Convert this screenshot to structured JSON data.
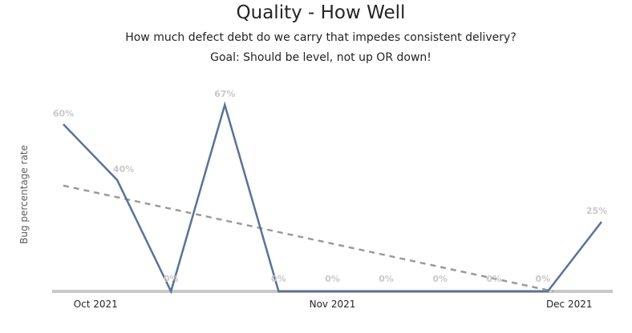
{
  "header": {
    "title": "Quality - How Well",
    "subtitle": "How much defect debt do we carry that impedes consistent delivery?",
    "goal": "Goal: Should be level, not up OR down!"
  },
  "colors": {
    "series_line": "#5b7295",
    "trend_line": "#9a9a9a",
    "axis_line": "#c8c8c8",
    "data_label": "#c8c8c8"
  },
  "chart_data": {
    "type": "line",
    "title": "Quality - How Well",
    "ylabel": "Bug percentage rate",
    "xlabel": "",
    "x_ticks": [
      "Oct 2021",
      "Nov 2021",
      "Dec 2021"
    ],
    "ylim": [
      0,
      67
    ],
    "grid": false,
    "series": [
      {
        "name": "",
        "values": [
          60,
          40,
          0,
          67,
          0,
          0,
          0,
          0,
          0,
          0,
          25
        ],
        "labels": [
          "60%",
          "40%",
          "0%",
          "67%",
          "0%",
          "0%",
          "0%",
          "0%",
          "0%",
          "0%",
          "25%"
        ]
      }
    ],
    "trend": {
      "style": "dashed",
      "start": 38,
      "end": 0
    }
  }
}
